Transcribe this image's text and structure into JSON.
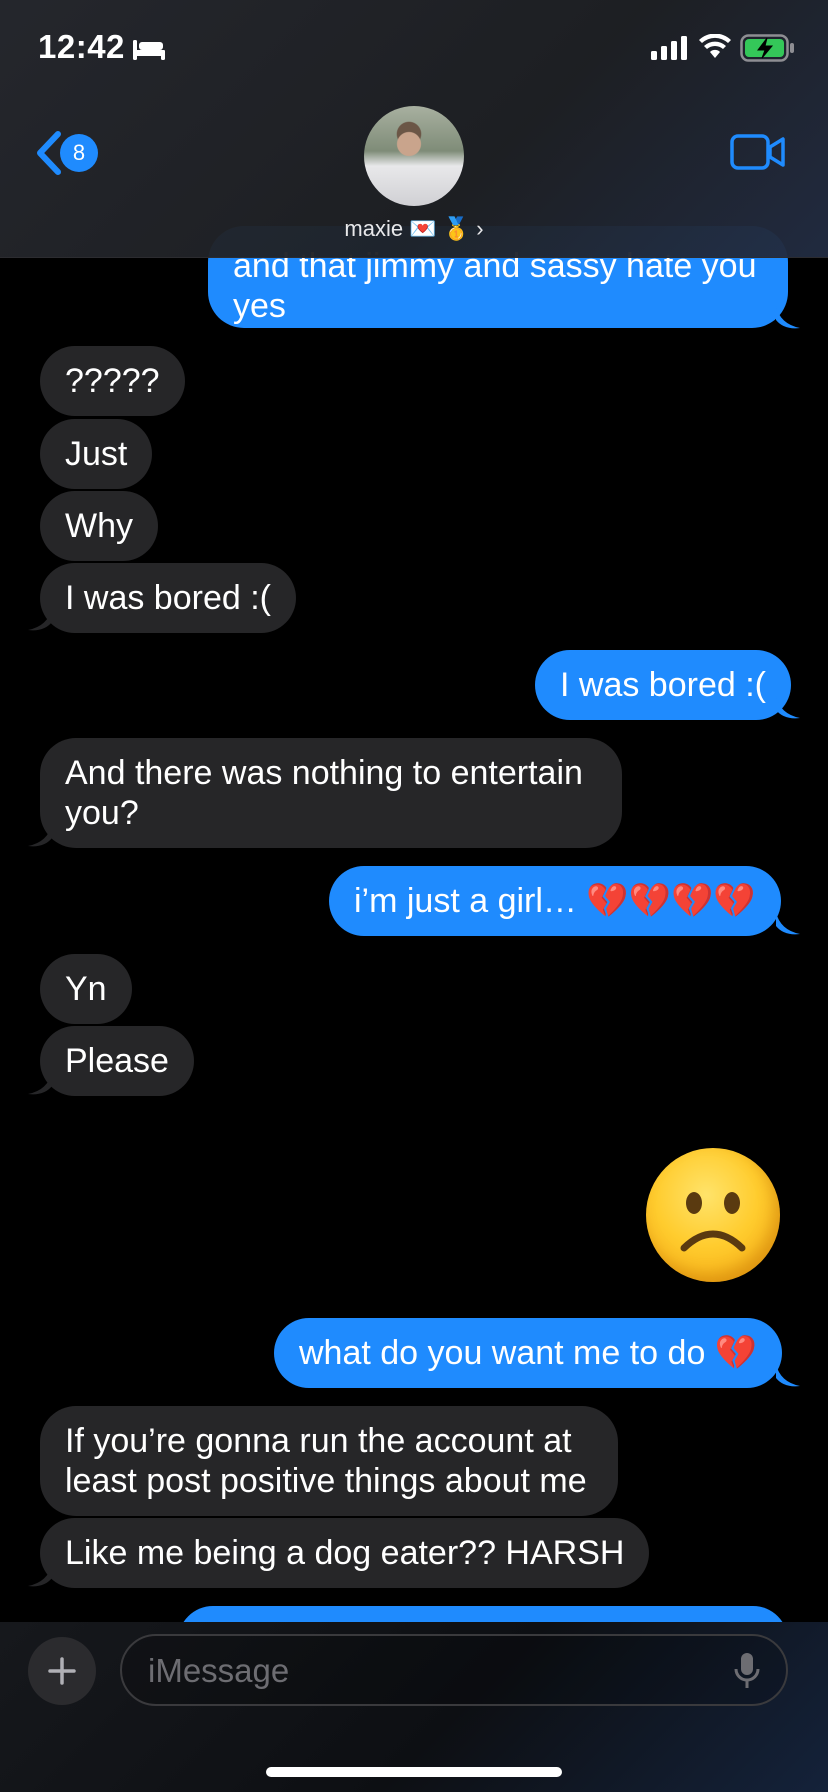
{
  "status_bar": {
    "time": "12:42"
  },
  "header": {
    "back_badge": "8",
    "contact_name": "maxie 💌 🥇 ›"
  },
  "messages": [
    {
      "dir": "out",
      "text": "and that jimmy and sassy hate you\nyes"
    },
    {
      "dir": "in",
      "text": "?????"
    },
    {
      "dir": "in",
      "text": "Just"
    },
    {
      "dir": "in",
      "text": "Why"
    },
    {
      "dir": "in",
      "text": "I was bored :("
    },
    {
      "dir": "out",
      "text": "I was bored :("
    },
    {
      "dir": "in",
      "text": "And there was nothing to entertain\nyou?"
    },
    {
      "dir": "out",
      "text": "i’m just a girl… 💔💔💔💔"
    },
    {
      "dir": "in",
      "text": "Yn"
    },
    {
      "dir": "in",
      "text": "Please"
    },
    {
      "dir": "out",
      "text": "what do you want me to do 💔"
    },
    {
      "dir": "in",
      "text": "If you’re gonna run the account at\nleast post positive things about me"
    },
    {
      "dir": "in",
      "text": "Like me being a dog eater?? HARSH"
    }
  ],
  "big_emoji": {
    "icon": "frowning-face-emoji"
  },
  "input": {
    "placeholder": "iMessage"
  },
  "colors": {
    "outgoing": "#1f8bfe",
    "incoming": "#262628",
    "accent": "#1f8bfe"
  }
}
